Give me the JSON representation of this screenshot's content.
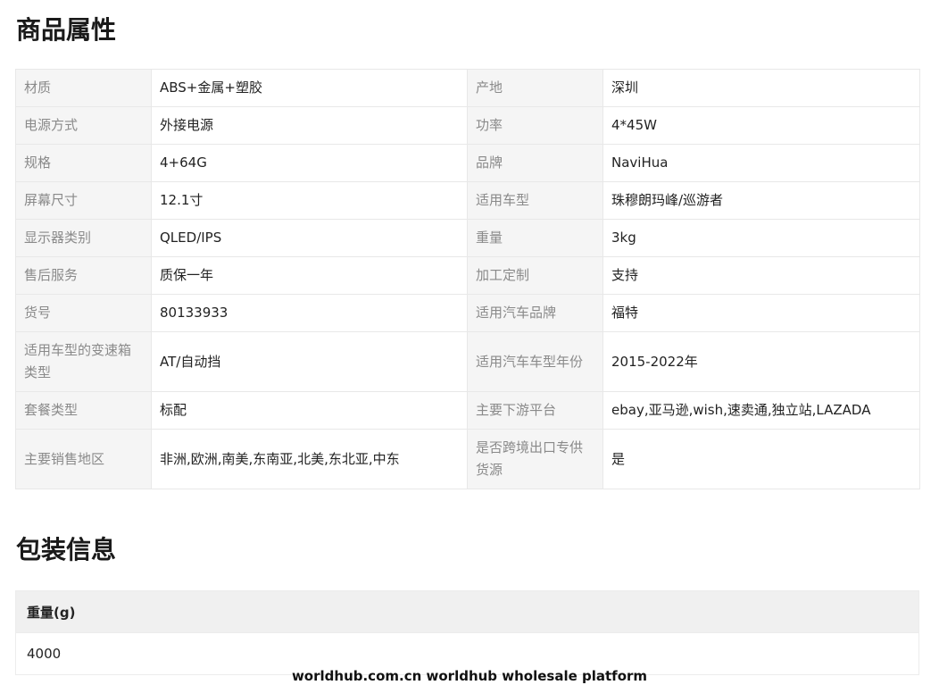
{
  "attributes": {
    "title": "商品属性",
    "rows": [
      {
        "k1": "材质",
        "v1": "ABS+金属+塑胶",
        "k2": "产地",
        "v2": "深圳"
      },
      {
        "k1": "电源方式",
        "v1": "外接电源",
        "k2": "功率",
        "v2": "4*45W"
      },
      {
        "k1": "规格",
        "v1": "4+64G",
        "k2": "品牌",
        "v2": "NaviHua"
      },
      {
        "k1": "屏幕尺寸",
        "v1": "12.1寸",
        "k2": "适用车型",
        "v2": "珠穆朗玛峰/巡游者"
      },
      {
        "k1": "显示器类别",
        "v1": "QLED/IPS",
        "k2": "重量",
        "v2": "3kg"
      },
      {
        "k1": "售后服务",
        "v1": "质保一年",
        "k2": "加工定制",
        "v2": "支持"
      },
      {
        "k1": "货号",
        "v1": "80133933",
        "k2": "适用汽车品牌",
        "v2": "福特"
      },
      {
        "k1": "适用车型的变速箱类型",
        "v1": "AT/自动挡",
        "k2": "适用汽车车型年份",
        "v2": "2015-2022年"
      },
      {
        "k1": "套餐类型",
        "v1": "标配",
        "k2": "主要下游平台",
        "v2": "ebay,亚马逊,wish,速卖通,独立站,LAZADA"
      },
      {
        "k1": "主要销售地区",
        "v1": "非洲,欧洲,南美,东南亚,北美,东北亚,中东",
        "k2": "是否跨境出口专供货源",
        "v2": "是"
      }
    ]
  },
  "packaging": {
    "title": "包装信息",
    "header": "重量(g)",
    "value": "4000"
  },
  "watermark": "worldhub.com.cn worldhub wholesale platform",
  "colors": {
    "key_bg": "#f5f5f5",
    "key_text": "#8a8a8a",
    "border": "#e8e8e8"
  }
}
